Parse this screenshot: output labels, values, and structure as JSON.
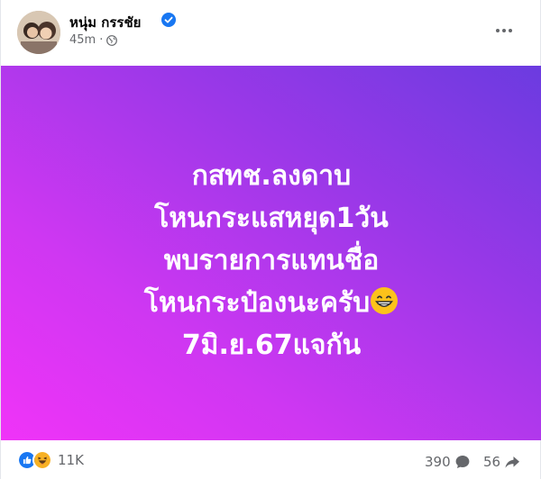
{
  "post": {
    "author": "หนุ่ม กรรชัย",
    "verified_icon": "verified-badge-icon",
    "timestamp": "45m",
    "audience_icon": "globe-icon",
    "more_icon": "more-options-icon",
    "brand_color": "#1877f2"
  },
  "banner": {
    "lines": [
      "กสทช.ลงดาบ",
      "โหนกระแสหยุด1วัน",
      "พบรายการแทนชื่อ",
      "โหนกระป๋องนะครับ",
      "7มิ.ย.67แจกัน"
    ],
    "emoji": "😁",
    "gradient_colors": [
      "#6b3be0",
      "#9b38e8",
      "#cf37f2",
      "#f033f8"
    ],
    "text_color": "#ffffff"
  },
  "stats": {
    "reaction_icons": [
      "like-icon",
      "haha-icon"
    ],
    "reactions": "11K",
    "comments": "390",
    "comment_icon": "comment-icon",
    "shares": "56",
    "share_icon": "share-icon"
  }
}
